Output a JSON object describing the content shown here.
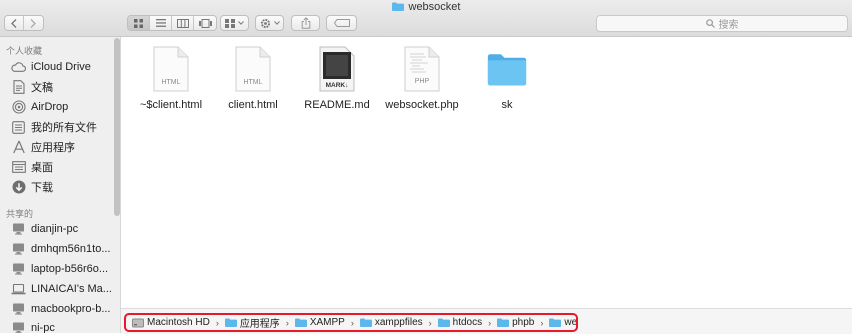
{
  "window": {
    "title": "websocket"
  },
  "search": {
    "placeholder": "搜索"
  },
  "sidebar": {
    "favorites_header": "个人收藏",
    "favorites": [
      {
        "label": "iCloud Drive",
        "icon": "cloud-icon"
      },
      {
        "label": "文稿",
        "icon": "document-icon"
      },
      {
        "label": "AirDrop",
        "icon": "airdrop-icon"
      },
      {
        "label": "我的所有文件",
        "icon": "all-files-icon"
      },
      {
        "label": "应用程序",
        "icon": "applications-icon"
      },
      {
        "label": "桌面",
        "icon": "desktop-icon"
      },
      {
        "label": "下载",
        "icon": "download-icon"
      }
    ],
    "shared_header": "共享的",
    "shared": [
      {
        "label": "dianjin-pc",
        "icon": "monitor-icon"
      },
      {
        "label": "dmhqm56n1to...",
        "icon": "monitor-icon"
      },
      {
        "label": "laptop-b56r6o...",
        "icon": "monitor-icon"
      },
      {
        "label": "LINAICAI's Ma...",
        "icon": "laptop-icon"
      },
      {
        "label": "macbookpro-b...",
        "icon": "monitor-icon"
      },
      {
        "label": "ni-pc",
        "icon": "monitor-icon"
      }
    ]
  },
  "files": [
    {
      "name": "~$client.html",
      "type_label": "HTML",
      "kind": "html"
    },
    {
      "name": "client.html",
      "type_label": "HTML",
      "kind": "html"
    },
    {
      "name": "README.md",
      "type_label": "MARK↓",
      "kind": "markdown"
    },
    {
      "name": "websocket.php",
      "type_label": "PHP",
      "kind": "php"
    },
    {
      "name": "sk",
      "type_label": "",
      "kind": "folder"
    }
  ],
  "path": [
    "Macintosh HD",
    "应用程序",
    "XAMPP",
    "xamppfiles",
    "htdocs",
    "phpb",
    "websocket"
  ],
  "colors": {
    "folder": "#5cb8ec",
    "path_highlight": "#e8182c",
    "sidebar_bg": "#efefef"
  }
}
